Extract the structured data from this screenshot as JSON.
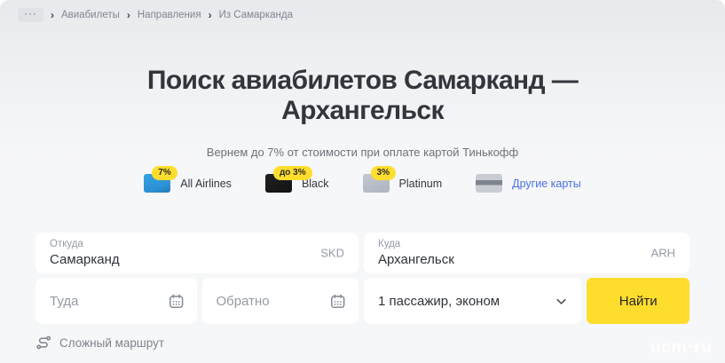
{
  "breadcrumb": {
    "more": "···",
    "items": [
      "Авиабилеты",
      "Направления",
      "Из Самарканда"
    ]
  },
  "hero": {
    "title_line1": "Поиск авиабилетов Самарканд —",
    "title_line2": "Архангельск",
    "subtitle": "Вернем до 7% от стоимости при оплате картой Тинькофф"
  },
  "cashback": {
    "cards": [
      {
        "badge": "7%",
        "label": "All Airlines",
        "card_color": "#2b90d4"
      },
      {
        "badge": "до 3%",
        "label": "Black",
        "card_color": "#161616"
      },
      {
        "badge": "3%",
        "label": "Platinum",
        "card_color": "#b5bbc5"
      },
      {
        "badge": "",
        "label": "Другие карты",
        "card_color": "#c9cdd3"
      }
    ]
  },
  "form": {
    "from_label": "Откуда",
    "from_value": "Самарканд",
    "from_code": "SKD",
    "to_label": "Куда",
    "to_value": "Архангельск",
    "to_code": "ARH",
    "depart_placeholder": "Туда",
    "return_placeholder": "Обратно",
    "passengers_value": "1 пассажир, эконом",
    "search_label": "Найти",
    "complex_route_label": "Сложный маршрут"
  },
  "colors": {
    "accent_yellow": "#ffdd2d",
    "link_blue": "#4a6fe3"
  },
  "watermark": "ucm·ru"
}
